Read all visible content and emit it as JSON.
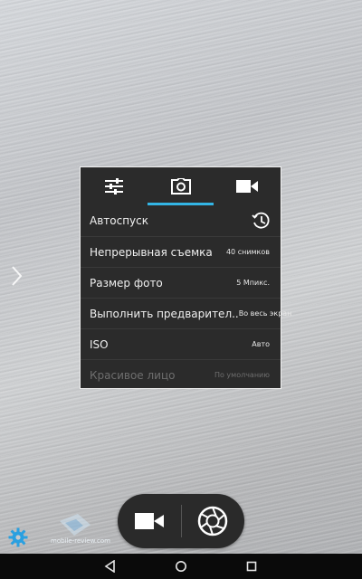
{
  "panel": {
    "tabs": [
      {
        "icon": "sliders-icon"
      },
      {
        "icon": "camera-icon",
        "active": true
      },
      {
        "icon": "video-camera-icon"
      }
    ],
    "rows": [
      {
        "label": "Автоспуск",
        "value_icon": "timer-icon"
      },
      {
        "label": "Непрерывная съемка",
        "value": "40 снимков"
      },
      {
        "label": "Размер фото",
        "value": "5 Мпикс."
      },
      {
        "label": "Выполнить предварител..",
        "value": "Во весь экран"
      },
      {
        "label": "ISO",
        "value": "Авто"
      },
      {
        "label": "Красивое лицо",
        "value": "По умолчанию",
        "disabled": true
      }
    ]
  },
  "controls": {
    "video_button_icon": "video-camera-icon",
    "shutter_button_icon": "shutter-icon",
    "settings_icon": "gear-icon"
  },
  "watermark": {
    "text": "mobile-review.com"
  },
  "navbar": {
    "icons": [
      "back-icon",
      "home-icon",
      "recents-icon"
    ]
  },
  "colors": {
    "accent": "#33b5e5",
    "panel_bg": "#2b2b2b",
    "settings_icon": "#2aa0e0"
  }
}
